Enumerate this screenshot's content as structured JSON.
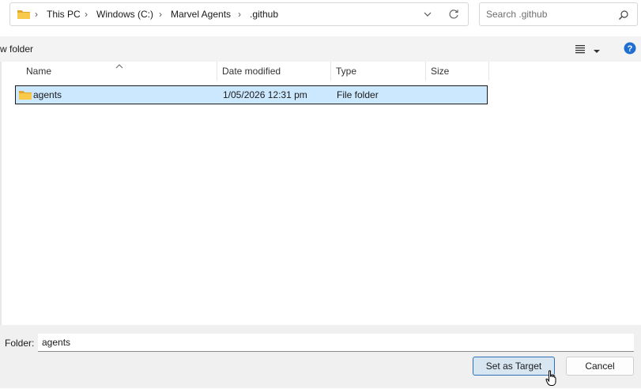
{
  "address_bar": {
    "breadcrumbs": [
      "This PC",
      "Windows (C:)",
      "Marvel Agents",
      ".github"
    ]
  },
  "search": {
    "placeholder": "Search .github",
    "value": ""
  },
  "toolbar": {
    "new_folder_label": "w folder"
  },
  "columns": [
    {
      "key": "name",
      "label": "Name",
      "sorted": true
    },
    {
      "key": "date",
      "label": "Date modified"
    },
    {
      "key": "type",
      "label": "Type"
    },
    {
      "key": "size",
      "label": "Size"
    }
  ],
  "rows": [
    {
      "name": "agents",
      "date": "1/05/2026 12:31 pm",
      "type": "File folder",
      "size": "",
      "selected": true
    }
  ],
  "footer": {
    "folder_label": "Folder:",
    "folder_value": "agents",
    "primary_button": "Set as Target",
    "cancel_button": "Cancel"
  },
  "colors": {
    "folder_yellow": "#f8c94a",
    "selection_bg": "#cce8ff",
    "help_blue": "#1f6fd1",
    "primary_border": "#2f6fb5"
  },
  "icons": [
    "folder-icon",
    "chevron-right-icon",
    "chevron-down-icon",
    "refresh-icon",
    "search-icon",
    "view-list-icon",
    "help-icon",
    "sort-up-icon",
    "mouse-cursor-icon"
  ]
}
